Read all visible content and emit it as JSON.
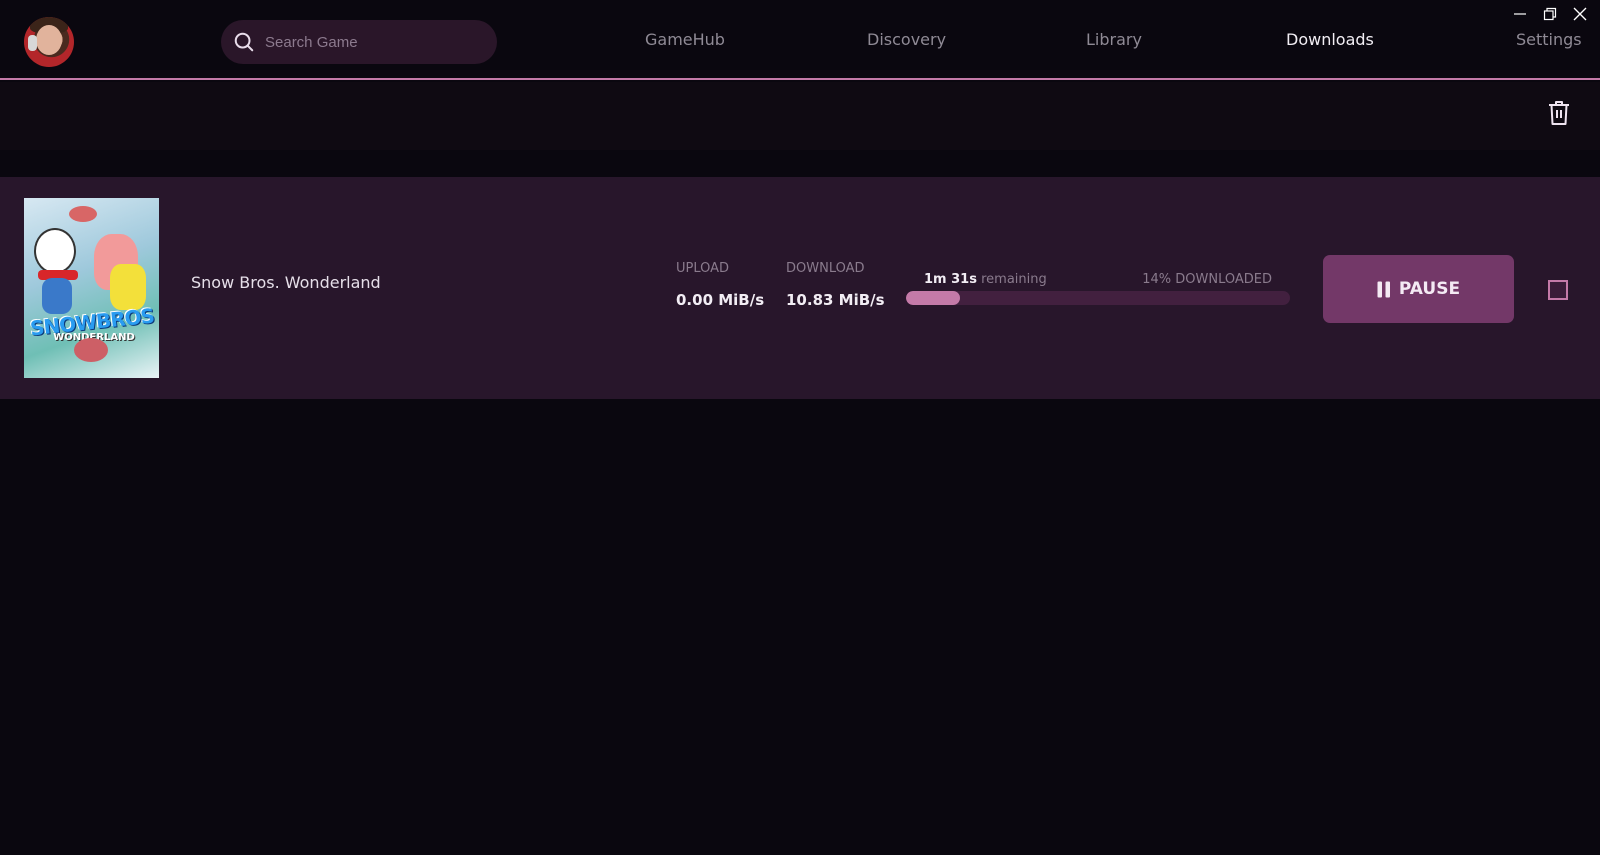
{
  "header": {
    "avatar_alt": "User avatar",
    "search": {
      "placeholder": "Search Game",
      "value": ""
    },
    "nav": [
      {
        "label": "GameHub",
        "active": false
      },
      {
        "label": "Discovery",
        "active": false
      },
      {
        "label": "Library",
        "active": false
      },
      {
        "label": "Downloads",
        "active": true
      },
      {
        "label": "Settings",
        "active": false
      }
    ],
    "window_controls": [
      "minimize-icon",
      "restore-icon",
      "close-icon"
    ]
  },
  "toolbar": {
    "clear_icon": "trash-icon"
  },
  "downloads": [
    {
      "title": "Snow Bros. Wonderland",
      "cover_logo": "SNOWBROS",
      "cover_logo_sub": "WONDERLAND",
      "upload_label": "UPLOAD",
      "upload_value": "0.00 MiB/s",
      "download_label": "DOWNLOAD",
      "download_value": "10.83 MiB/s",
      "time_remaining": "1m 31s",
      "remaining_suffix": "remaining",
      "percent_label": "14% DOWNLOADED",
      "progress_fraction": 0.14,
      "pause_label": "PAUSE",
      "selected": false
    }
  ],
  "colors": {
    "accent": "#c47aa8",
    "row_background": "#28162b",
    "button_background": "#733868",
    "app_background": "#0a070f"
  }
}
